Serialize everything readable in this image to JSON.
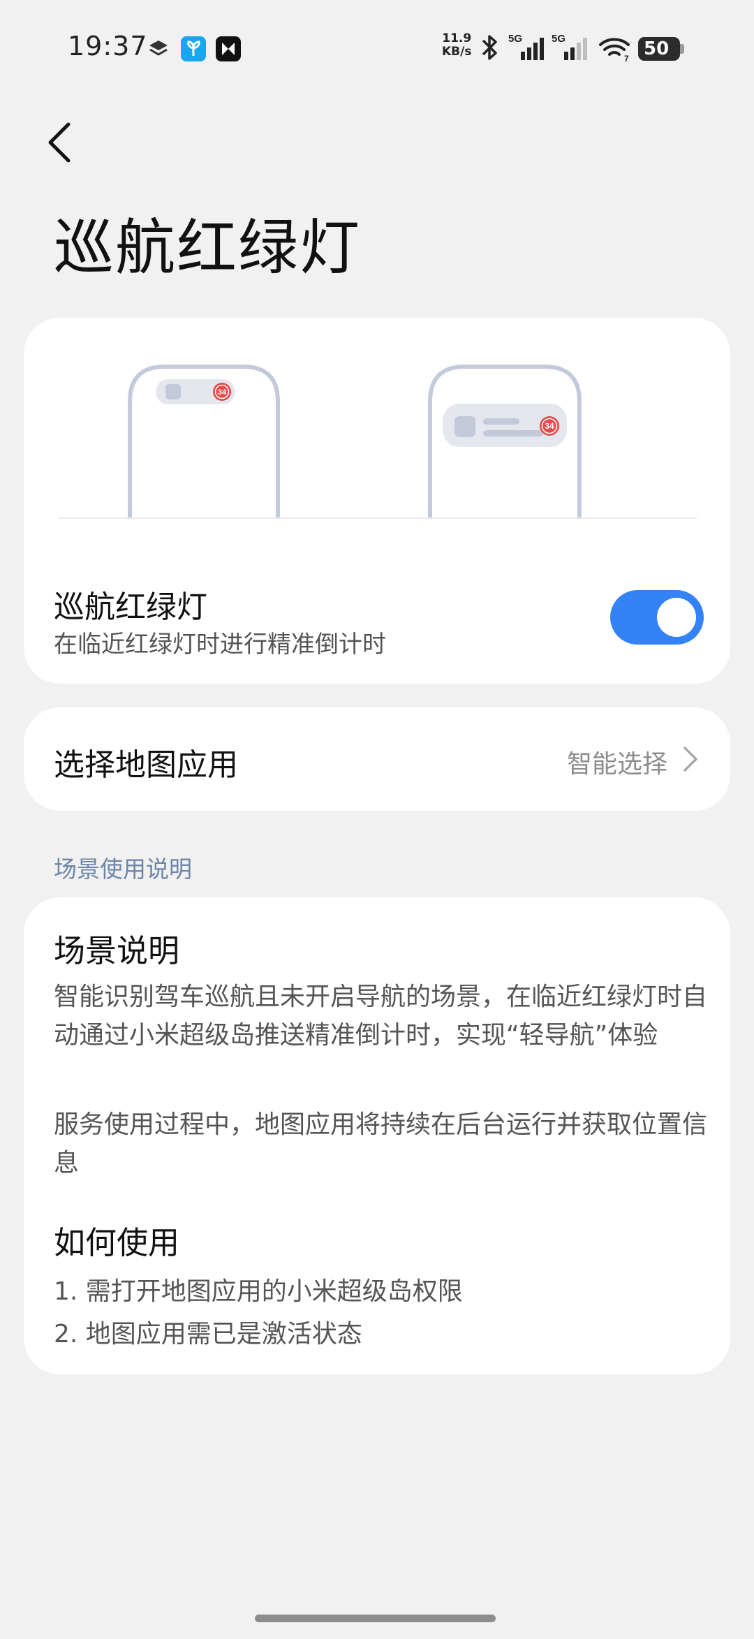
{
  "status_bar": {
    "time": "19:37",
    "net_speed_value": "11.9",
    "net_speed_unit": "KB/s",
    "signal_1_label": "5G",
    "signal_2_label": "5G",
    "wifi_label": "7",
    "battery": "50",
    "icons": [
      "layers-icon",
      "app-leaf-icon",
      "app-x-icon",
      "bluetooth-icon",
      "cell-signal-icon",
      "cell-signal-icon",
      "wifi-icon",
      "battery-icon"
    ]
  },
  "header": {
    "back_icon": "chevron-left-icon",
    "title": "巡航红绿灯"
  },
  "preview": {
    "badge_left": "34",
    "badge_right": "34"
  },
  "toggle_card": {
    "title": "巡航红绿灯",
    "description": "在临近红绿灯时进行精准倒计时",
    "enabled": true,
    "accent_color": "#3482f6"
  },
  "map_card": {
    "label": "选择地图应用",
    "value": "智能选择",
    "chevron_icon": "chevron-right-icon"
  },
  "section_label": "场景使用说明",
  "info_card": {
    "heading_1": "场景说明",
    "paragraph_1": "智能识别驾车巡航且未开启导航的场景，在临近红绿灯时自动通过小米超级岛推送精准倒计时，实现“轻导航”体验",
    "paragraph_2": "服务使用过程中，地图应用将持续在后台运行并获取位置信息",
    "heading_2": "如何使用",
    "steps": [
      "1. 需打开地图应用的小米超级岛权限",
      "2. 地图应用需已是激活状态"
    ]
  }
}
